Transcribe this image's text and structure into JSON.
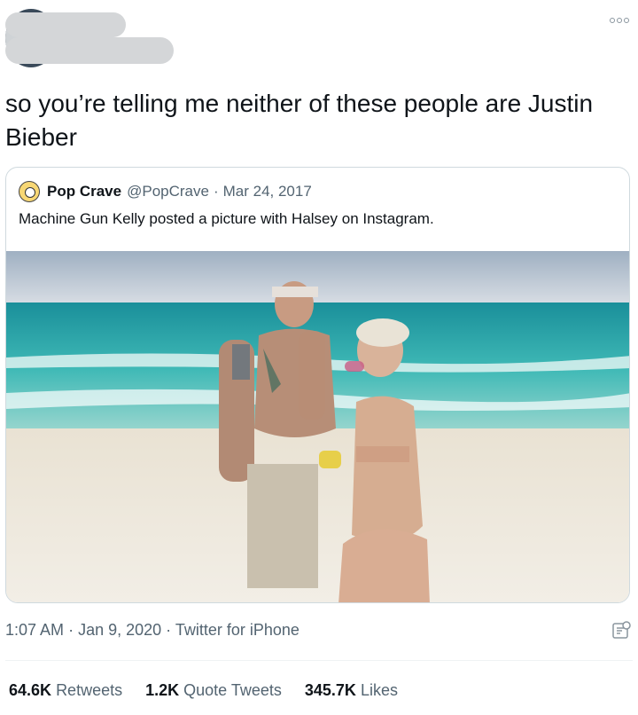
{
  "tweet": {
    "text": "so you’re telling me neither of these people are Justin Bieber",
    "time": "1:07 AM",
    "date": "Jan 9, 2020",
    "source": "Twitter for iPhone",
    "more_icon": "more-horizontal-icon"
  },
  "quoted_tweet": {
    "display_name": "Pop Crave",
    "handle": "@PopCrave",
    "separator": "·",
    "date": "Mar 24, 2017",
    "text": "Machine Gun Kelly posted a picture with Halsey on Instagram."
  },
  "stats": {
    "retweets_count": "64.6K",
    "retweets_label": "Retweets",
    "quote_count": "1.2K",
    "quote_label": "Quote Tweets",
    "likes_count": "345.7K",
    "likes_label": "Likes"
  },
  "colors": {
    "text_primary": "#0f1419",
    "text_secondary": "#536471",
    "border": "#cfd9de"
  }
}
